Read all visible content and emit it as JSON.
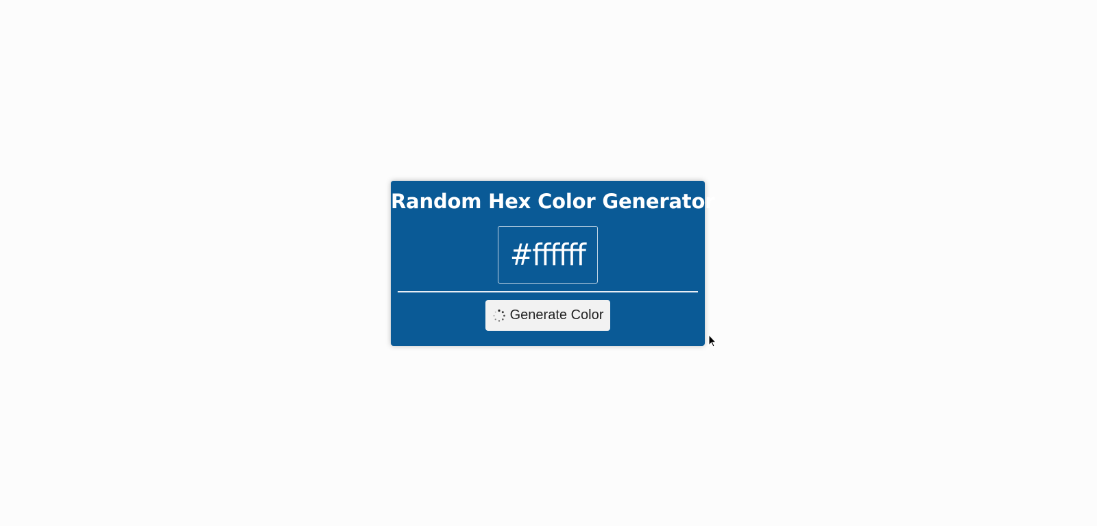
{
  "app": {
    "title": "Random Hex Color Generator"
  },
  "display": {
    "hex_value": "#ffffff"
  },
  "controls": {
    "generate_label": "Generate Color",
    "generate_icon": "spinner-icon"
  },
  "colors": {
    "page_background": "#fcfcfc",
    "card_background": "#0a5a96",
    "text": "#ffffff",
    "button_background": "#f2f2f2",
    "button_text": "#222222"
  }
}
